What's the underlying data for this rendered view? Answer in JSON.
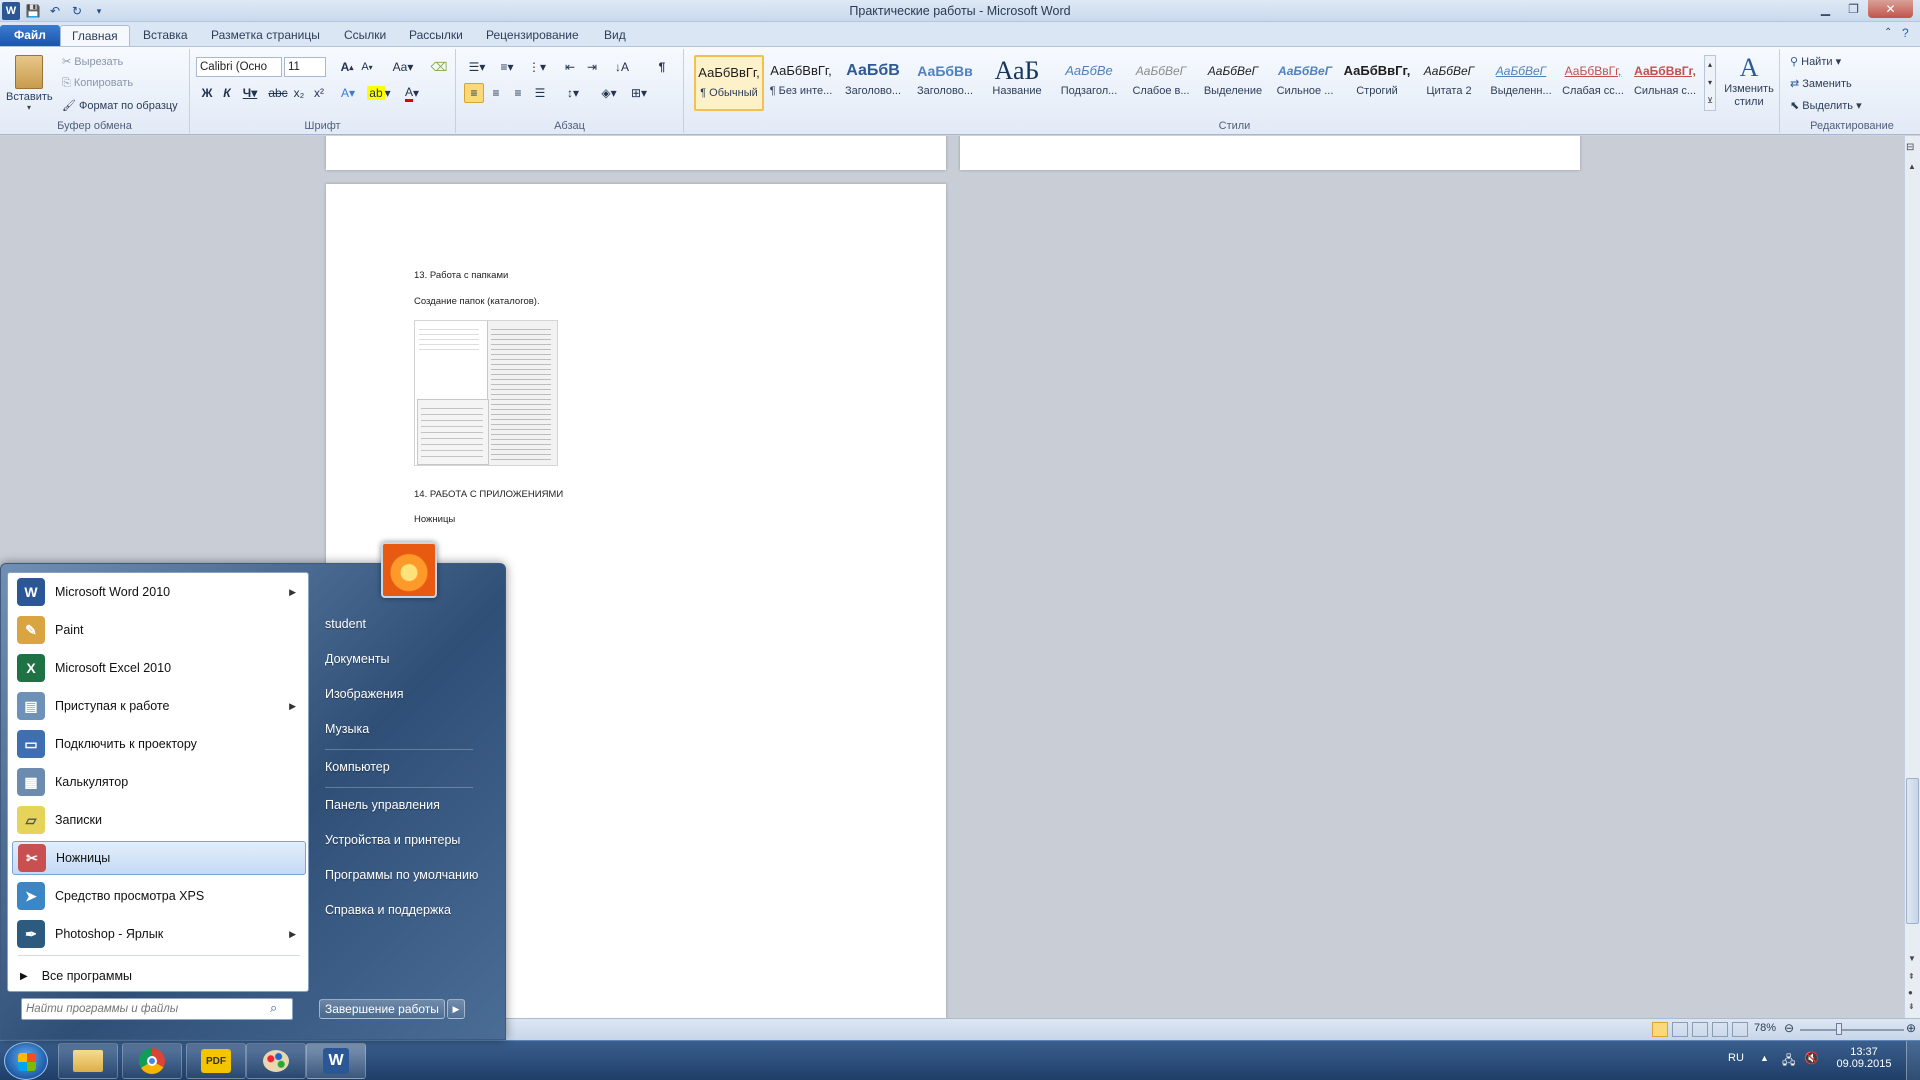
{
  "window": {
    "title": "Практические  работы - Microsoft Word"
  },
  "tabs": [
    "Файл",
    "Главная",
    "Вставка",
    "Разметка страницы",
    "Ссылки",
    "Рассылки",
    "Рецензирование",
    "Вид"
  ],
  "ribbon": {
    "clipboard": {
      "paste": "Вставить",
      "cut": "Вырезать",
      "copy": "Копировать",
      "format_painter": "Формат по образцу",
      "label": "Буфер обмена"
    },
    "font": {
      "name": "Calibri (Осно",
      "size": "11",
      "label": "Шрифт"
    },
    "paragraph": {
      "label": "Абзац"
    },
    "styles": {
      "label": "Стили",
      "items": [
        {
          "sample": "АаБбВвГг,",
          "name": "¶ Обычный",
          "selected": true
        },
        {
          "sample": "АаБбВвГг,",
          "name": "¶ Без инте..."
        },
        {
          "sample": "АаБбВ",
          "name": "Заголово..."
        },
        {
          "sample": "АаБбВв",
          "name": "Заголово..."
        },
        {
          "sample": "АаБ",
          "name": "Название"
        },
        {
          "sample": "АаБбВе",
          "name": "Подзагол..."
        },
        {
          "sample": "АаБбВеГ",
          "name": "Слабое в..."
        },
        {
          "sample": "АаБбВеГ",
          "name": "Выделение"
        },
        {
          "sample": "АаБбВеГ",
          "name": "Сильное ..."
        },
        {
          "sample": "АаБбВвГг,",
          "name": "Строгий"
        },
        {
          "sample": "АаБбВеГ",
          "name": "Цитата 2"
        },
        {
          "sample": "АаБбВеГ",
          "name": "Выделенн..."
        },
        {
          "sample": "АаБбВвГг,",
          "name": "Слабая сс..."
        },
        {
          "sample": "АаБбВвГг,",
          "name": "Сильная с..."
        }
      ],
      "change": "Изменить стили"
    },
    "editing": {
      "find": "Найти",
      "replace": "Заменить",
      "select": "Выделить",
      "label": "Редактирование"
    }
  },
  "document": {
    "line1": "13. Работа с папками",
    "line2": "Создание папок (каталогов).",
    "line3": "14. РАБОТА  С ПРИЛОЖЕНИЯМИ",
    "line4": "Ножницы"
  },
  "status": {
    "zoom": "78%"
  },
  "startmenu": {
    "programs": [
      {
        "label": "Microsoft Word 2010",
        "icon": "word-icon",
        "arrow": true,
        "color": "#2b5797"
      },
      {
        "label": "Paint",
        "icon": "paint-icon",
        "arrow": false,
        "color": "#d9a441"
      },
      {
        "label": "Microsoft Excel 2010",
        "icon": "excel-icon",
        "arrow": false,
        "color": "#1f7244"
      },
      {
        "label": "Приступая к работе",
        "icon": "getting-started-icon",
        "arrow": true,
        "color": "#6e91b8"
      },
      {
        "label": "Подключить к проектору",
        "icon": "projector-icon",
        "arrow": false,
        "color": "#3f6fb0"
      },
      {
        "label": "Калькулятор",
        "icon": "calculator-icon",
        "arrow": false,
        "color": "#6b8cae"
      },
      {
        "label": "Записки",
        "icon": "sticky-notes-icon",
        "arrow": false,
        "color": "#e5d35a"
      },
      {
        "label": "Ножницы",
        "icon": "snipping-tool-icon",
        "arrow": false,
        "color": "#c85050",
        "highlight": true
      },
      {
        "label": "Средство просмотра XPS",
        "icon": "xps-viewer-icon",
        "arrow": false,
        "color": "#3d86c6"
      },
      {
        "label": "Photoshop - Ярлык",
        "icon": "photoshop-icon",
        "arrow": true,
        "color": "#2d5a7f"
      }
    ],
    "all_programs": "Все программы",
    "search_placeholder": "Найти программы и файлы",
    "right": [
      "student",
      "Документы",
      "Изображения",
      "Музыка",
      "Компьютер",
      "Панель управления",
      "Устройства и принтеры",
      "Программы по умолчанию",
      "Справка и поддержка"
    ],
    "shutdown": "Завершение работы"
  },
  "taskbar": {
    "lang": "RU",
    "time": "13:37",
    "date": "09.09.2015"
  }
}
